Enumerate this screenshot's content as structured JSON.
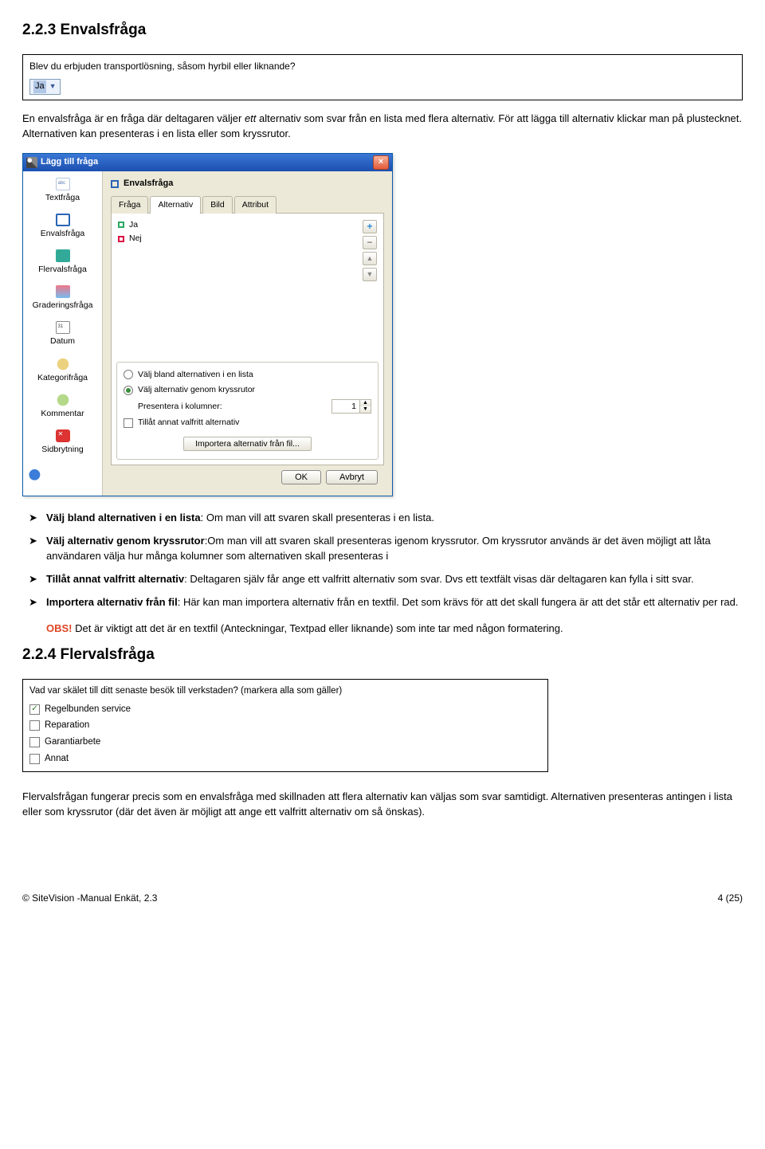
{
  "section1": {
    "heading": "2.2.3 Envalsfråga",
    "example_question": "Blev du erbjuden transportlösning, såsom hyrbil eller liknande?",
    "example_selected": "Ja",
    "intro_pre": "En envalsfråga är en fråga där deltagaren väljer ",
    "intro_ital": "ett",
    "intro_post": " alternativ som svar från en lista med flera alternativ. För att lägga till alternativ klickar man på plustecknet. Alternativen kan presenteras i en lista eller som kryssrutor."
  },
  "dialog": {
    "title": "Lägg till fråga",
    "sidebar": [
      "Textfråga",
      "Envalsfråga",
      "Flervalsfråga",
      "Graderingsfråga",
      "Datum",
      "Kategorifråga",
      "Kommentar",
      "Sidbrytning"
    ],
    "right_title": "Envalsfråga",
    "tabs": [
      "Fråga",
      "Alternativ",
      "Bild",
      "Attribut"
    ],
    "active_tab": "Alternativ",
    "options_list": [
      "Ja",
      "Nej"
    ],
    "radio1": "Välj bland alternativen i en lista",
    "radio2": "Välj alternativ genom kryssrutor",
    "spinner_label": "Presentera i kolumner:",
    "spinner_value": "1",
    "checkbox": "Tillåt annat valfritt alternativ",
    "import_btn": "Importera alternativ från fil...",
    "ok": "OK",
    "cancel": "Avbryt"
  },
  "bullets": {
    "b1_bold": "Välj bland alternativen i en lista",
    "b1_rest": ": Om man vill att svaren skall presenteras i en lista.",
    "b2_bold": "Välj alternativ genom kryssrutor",
    "b2_rest": ":Om man vill att svaren skall presenteras igenom kryssrutor. Om kryssrutor används är det även möjligt att låta användaren välja hur många kolumner som alternativen skall presenteras i",
    "b3_bold": "Tillåt annat valfritt alternativ",
    "b3_rest": ": Deltagaren själv får ange ett valfritt alternativ som svar. Dvs ett textfält visas där deltagaren kan fylla i sitt svar.",
    "b4_bold": "Importera alternativ från fil",
    "b4_rest": ": Här kan man importera alternativ från en textfil. Det som krävs för att det skall fungera är att det står ett alternativ per rad.",
    "obs_label": "OBS!",
    "obs_text": " Det är viktigt att det är en textfil (Anteckningar, Textpad eller liknande) som inte tar med någon formatering."
  },
  "section2": {
    "heading": "2.2.4 Flervalsfråga",
    "example_question": "Vad var skälet till ditt senaste besök till verkstaden? (markera alla som gäller)",
    "opts": [
      "Regelbunden service",
      "Reparation",
      "Garantiarbete",
      "Annat"
    ],
    "checked_index": 0,
    "para": "Flervalsfrågan fungerar precis som en envalsfråga med skillnaden att flera alternativ kan väljas  som svar samtidigt. Alternativen presenteras antingen i lista eller som kryssrutor (där det även är möjligt att ange ett valfritt alternativ om så önskas)."
  },
  "footer": {
    "left": "© SiteVision -Manual Enkät, 2.3",
    "right": "4 (25)"
  }
}
